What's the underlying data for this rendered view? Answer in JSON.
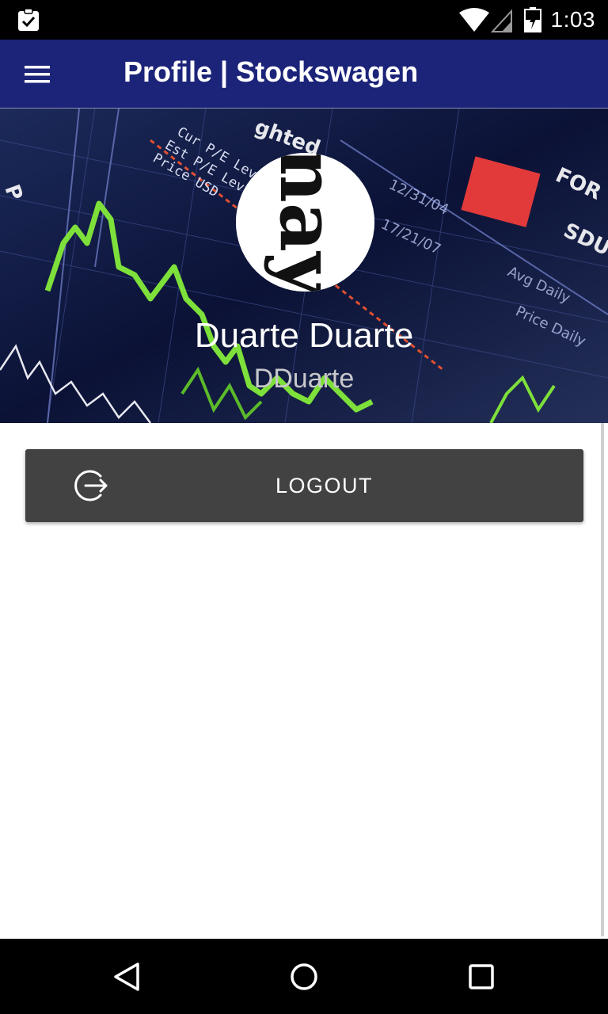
{
  "status_bar": {
    "time": "1:03",
    "icons": [
      "clipboard-check-icon",
      "wifi-icon",
      "signal-icon",
      "battery-icon"
    ]
  },
  "app_bar": {
    "title": "Profile | Stockswagen",
    "background_color": "#1c2479",
    "menu_icon": "hamburger-menu-icon"
  },
  "profile": {
    "name": "Duarte Duarte",
    "username": "DDuarte",
    "avatar_text": "nay",
    "background": "stock-chart-image"
  },
  "actions": {
    "logout_label": "LOGOUT",
    "logout_icon": "logout-icon",
    "button_color": "#424242"
  },
  "nav_bar": {
    "icons": [
      "back-icon",
      "home-icon",
      "recents-icon"
    ]
  }
}
